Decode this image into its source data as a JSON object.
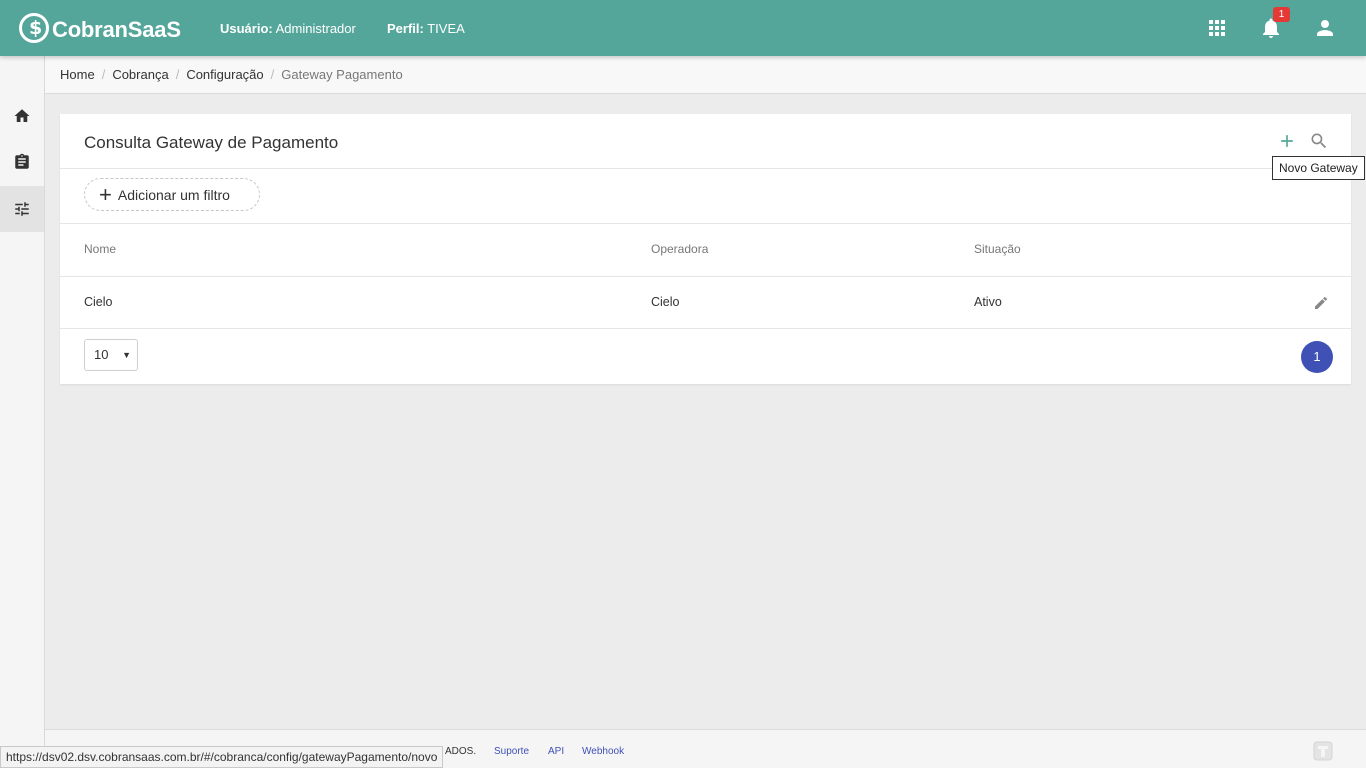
{
  "header": {
    "brand": "CobranSaaS",
    "user_label": "Usuário:",
    "user_value": "Administrador",
    "profile_label": "Perfil:",
    "profile_value": "TIVEA",
    "notification_count": "1",
    "icons": [
      "apps-grid-icon",
      "bell-icon",
      "account-icon"
    ],
    "color": "#55a69a"
  },
  "sidebar": {
    "items": [
      {
        "icon": "home-icon"
      },
      {
        "icon": "clipboard-icon"
      },
      {
        "icon": "settings-sliders-icon",
        "active": true
      }
    ]
  },
  "breadcrumb": [
    "Home",
    "Cobrança",
    "Configuração",
    "Gateway Pagamento"
  ],
  "card": {
    "title": "Consulta Gateway de Pagamento",
    "add_filter_label": "Adicionar um filtro",
    "tooltip": "Novo Gateway",
    "columns": [
      "Nome",
      "Operadora",
      "Situação"
    ],
    "rows": [
      {
        "nome": "Cielo",
        "operadora": "Cielo",
        "situacao": "Ativo"
      }
    ],
    "page_size": "10",
    "current_page": "1",
    "accent_color": "#3f51b5"
  },
  "footer": {
    "copyright_partial": "ADOS.",
    "links": [
      "Suporte",
      "API",
      "Webhook"
    ]
  },
  "status_url": "https://dsv02.dsv.cobransaas.com.br/#/cobranca/config/gatewayPagamento/novo"
}
